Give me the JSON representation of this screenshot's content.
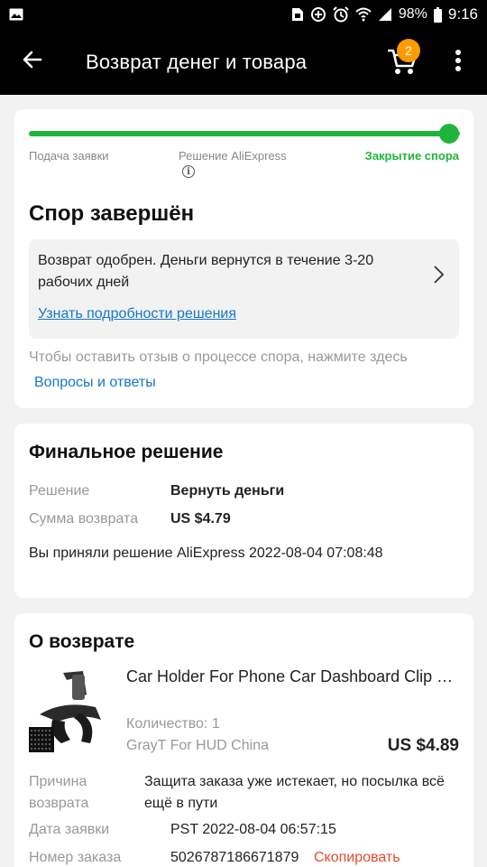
{
  "status_bar": {
    "battery": "98%",
    "time": "9:16",
    "icons": [
      "image-icon",
      "sim-icon",
      "data-saver-icon",
      "alarm-icon",
      "wifi-icon",
      "signal-icon",
      "battery-icon"
    ]
  },
  "app_bar": {
    "title": "Возврат денег и товара",
    "cart_count": "2",
    "icons": [
      "back-arrow-icon",
      "cart-icon",
      "more-vert-icon"
    ]
  },
  "dispute": {
    "progress": 1.0,
    "steps": [
      "Подача заявки",
      "Решение AliExpress",
      "Закрытие спора"
    ],
    "title": "Спор завершён",
    "notice_text": "Возврат одобрен. Деньги вернутся в течение 3-20 рабочих дней",
    "notice_link": "Узнать подробности решения",
    "hint": "Чтобы оставить отзыв о процессе спора, нажмите здесь",
    "qa_link": "Вопросы и ответы"
  },
  "final_decision": {
    "title": "Финальное решение",
    "decision_label": "Решение",
    "decision_value": "Вернуть деньги",
    "amount_label": "Сумма возврата",
    "amount_value": "US $4.79",
    "accepted": "Вы приняли решение AliExpress 2022-08-04 07:08:48"
  },
  "about_return": {
    "title": "О возврате",
    "product_name": "Car Holder For Phone Car Dashboard Clip Mount",
    "quantity": "Количество: 1",
    "store": "GrayT For HUD China",
    "price": "US $4.89",
    "reason_label": "Причина возврата",
    "reason_value": "Защита заказа уже истекает, но посылка всё ещё в пути",
    "date_label": "Дата заявки",
    "date_value": "PST 2022-08-04 06:57:15",
    "order_label": "Номер заказа",
    "order_value": "5026787186671879",
    "copy_label": "Скопировать"
  },
  "colors": {
    "accent_green": "#1fb53a",
    "link_blue": "#1677c9",
    "copy_red": "#e64a2e",
    "badge_orange": "#ff9a00"
  }
}
